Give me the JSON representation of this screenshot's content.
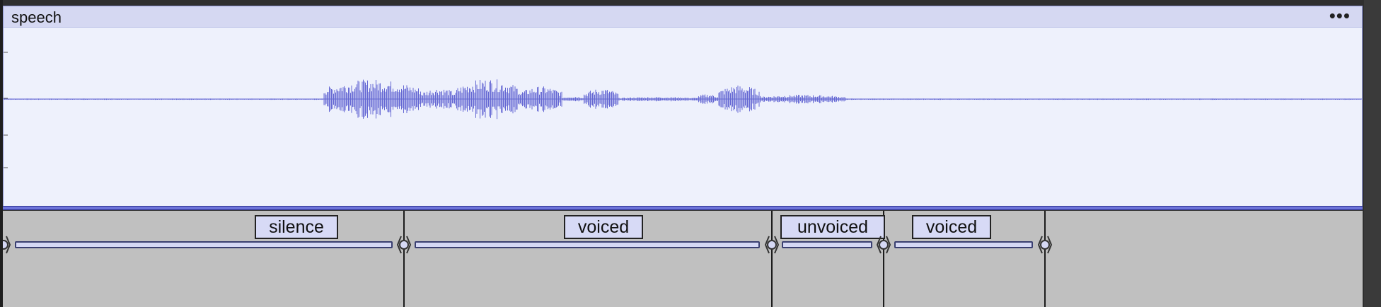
{
  "track": {
    "name": "speech",
    "menu_icon": "more-horizontal-icon",
    "waveform_color": "#6467d3",
    "background": "#eef1fc",
    "header_background": "#d5d8f2"
  },
  "label_track": {
    "background": "#c0c0c0",
    "labels": [
      {
        "text": "silence"
      },
      {
        "text": "voiced"
      },
      {
        "text": "unvoiced"
      },
      {
        "text": "voiced"
      }
    ]
  }
}
